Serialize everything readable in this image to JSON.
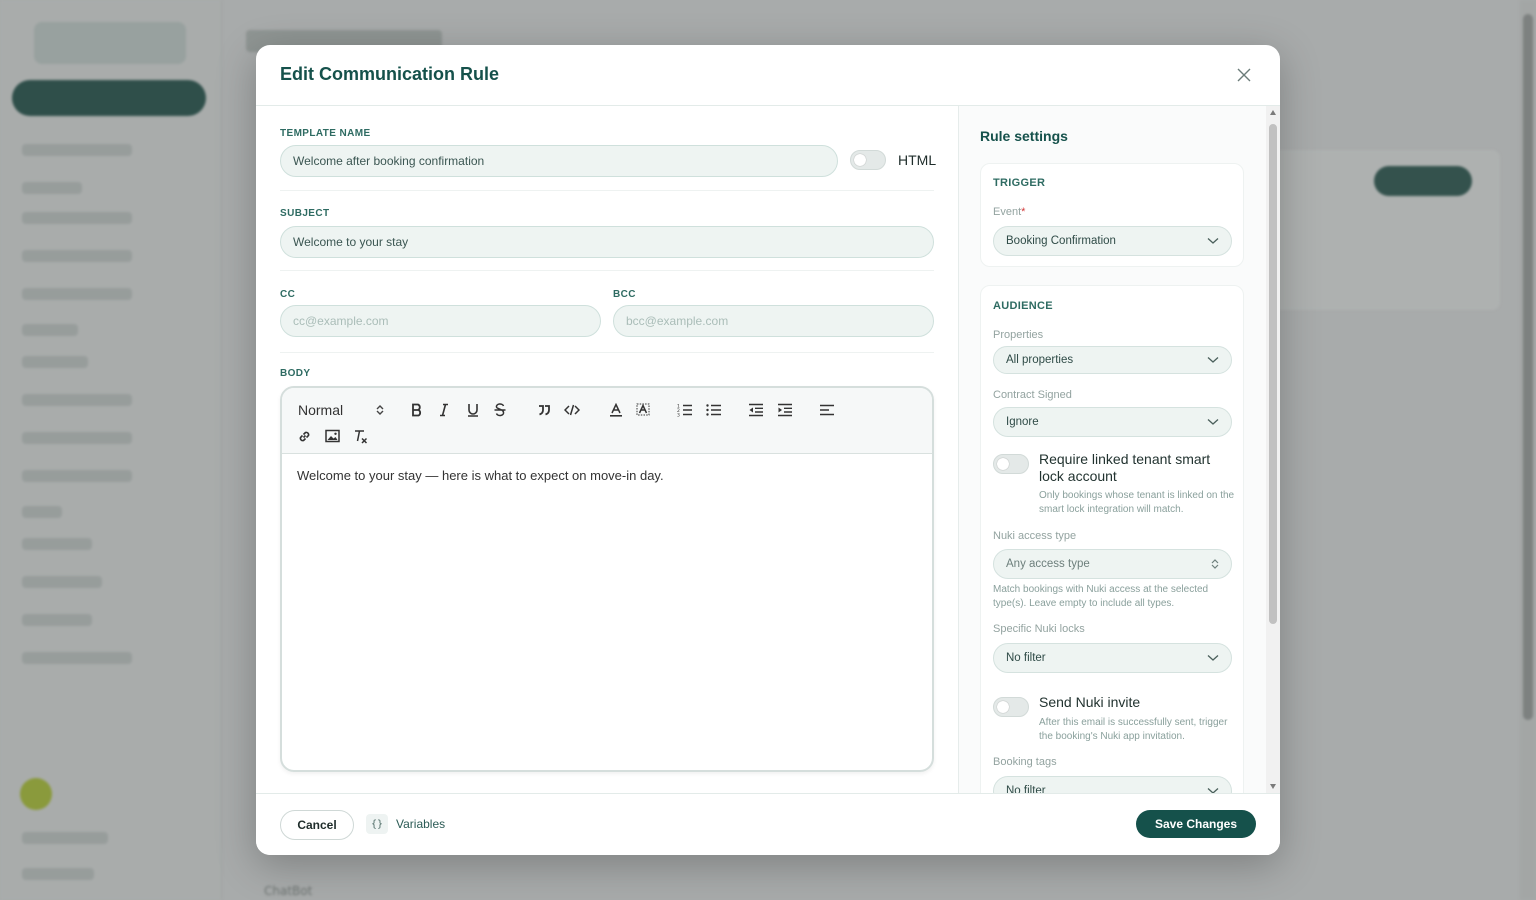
{
  "background": {
    "chatbot_label": "ChatBot"
  },
  "modal": {
    "title": "Edit Communication Rule"
  },
  "form": {
    "template_name": {
      "label": "TEMPLATE NAME",
      "value": "Welcome after booking confirmation"
    },
    "html_toggle": {
      "label": "HTML",
      "on": false
    },
    "subject": {
      "label": "SUBJECT",
      "value": "Welcome to your stay"
    },
    "cc": {
      "label": "CC",
      "placeholder": "cc@example.com"
    },
    "bcc": {
      "label": "BCC",
      "placeholder": "bcc@example.com"
    },
    "body": {
      "label": "BODY",
      "format": "Normal",
      "content": "Welcome to your stay — here is what to expect on move-in day."
    }
  },
  "footer": {
    "cancel_label": "Cancel",
    "variables_icon": "{}",
    "variables_label": "Variables",
    "save_label": "Save Changes"
  },
  "rule_settings": {
    "title": "Rule settings",
    "trigger": {
      "title": "TRIGGER",
      "event_label": "Event",
      "event_required": "*",
      "event_value": "Booking Confirmation"
    },
    "audience": {
      "title": "AUDIENCE",
      "properties_label": "Properties",
      "properties_value": "All properties",
      "contract_label": "Contract Signed",
      "contract_value": "Ignore",
      "smart_lock_label": "Require linked tenant smart lock account",
      "smart_lock_help": "Only bookings whose tenant is linked on the smart lock integration will match.",
      "nuki_access_label": "Nuki access type",
      "nuki_access_value": "Any access type",
      "nuki_access_help": "Match bookings with Nuki access at the selected type(s). Leave empty to include all types.",
      "nuki_locks_label": "Specific Nuki locks",
      "nuki_locks_value": "No filter",
      "nuki_invite_label": "Send Nuki invite",
      "nuki_invite_help": "After this email is successfully sent, trigger the booking's Nuki app invitation.",
      "booking_tags_label": "Booking tags",
      "booking_tags_value": "No filter"
    }
  },
  "colors": {
    "brand": "#15514b",
    "accent_text": "#2e6b62",
    "required": "#d23a3a"
  }
}
